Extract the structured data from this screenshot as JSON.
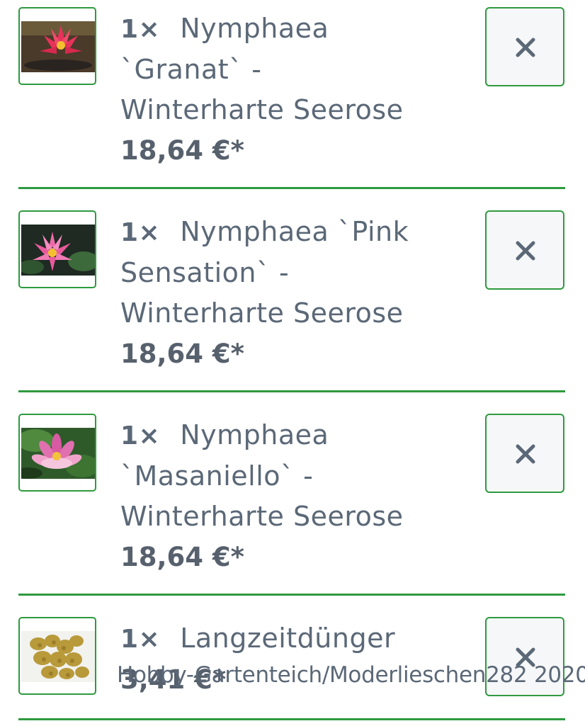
{
  "cart": {
    "items": [
      {
        "qty": "1×",
        "lines": [
          "Nymphaea",
          "`Granat` -",
          "Winterharte Seerose"
        ],
        "price": "18,64 €*",
        "image": "red-water-lily",
        "remove_icon": "close-icon"
      },
      {
        "qty": "1×",
        "lines": [
          "Nymphaea `Pink",
          "Sensation` -",
          "Winterharte Seerose"
        ],
        "price": "18,64 €*",
        "image": "pink-water-lily",
        "remove_icon": "close-icon"
      },
      {
        "qty": "1×",
        "lines": [
          "Nymphaea",
          "`Masaniello` -",
          "Winterharte Seerose"
        ],
        "price": "18,64 €*",
        "image": "pink-water-lily-leaves",
        "remove_icon": "close-icon"
      },
      {
        "qty": "1×",
        "lines": [
          "Langzeitdünger"
        ],
        "price": "3,41 €*",
        "image": "fertilizer-pellets",
        "remove_icon": "close-icon"
      }
    ]
  },
  "watermark": "Hobby-Gartenteich/Moderlieschen282 2020",
  "colors": {
    "accent": "#2e9a3f",
    "text": "#5b6877",
    "button_bg": "#f6f7f9"
  }
}
